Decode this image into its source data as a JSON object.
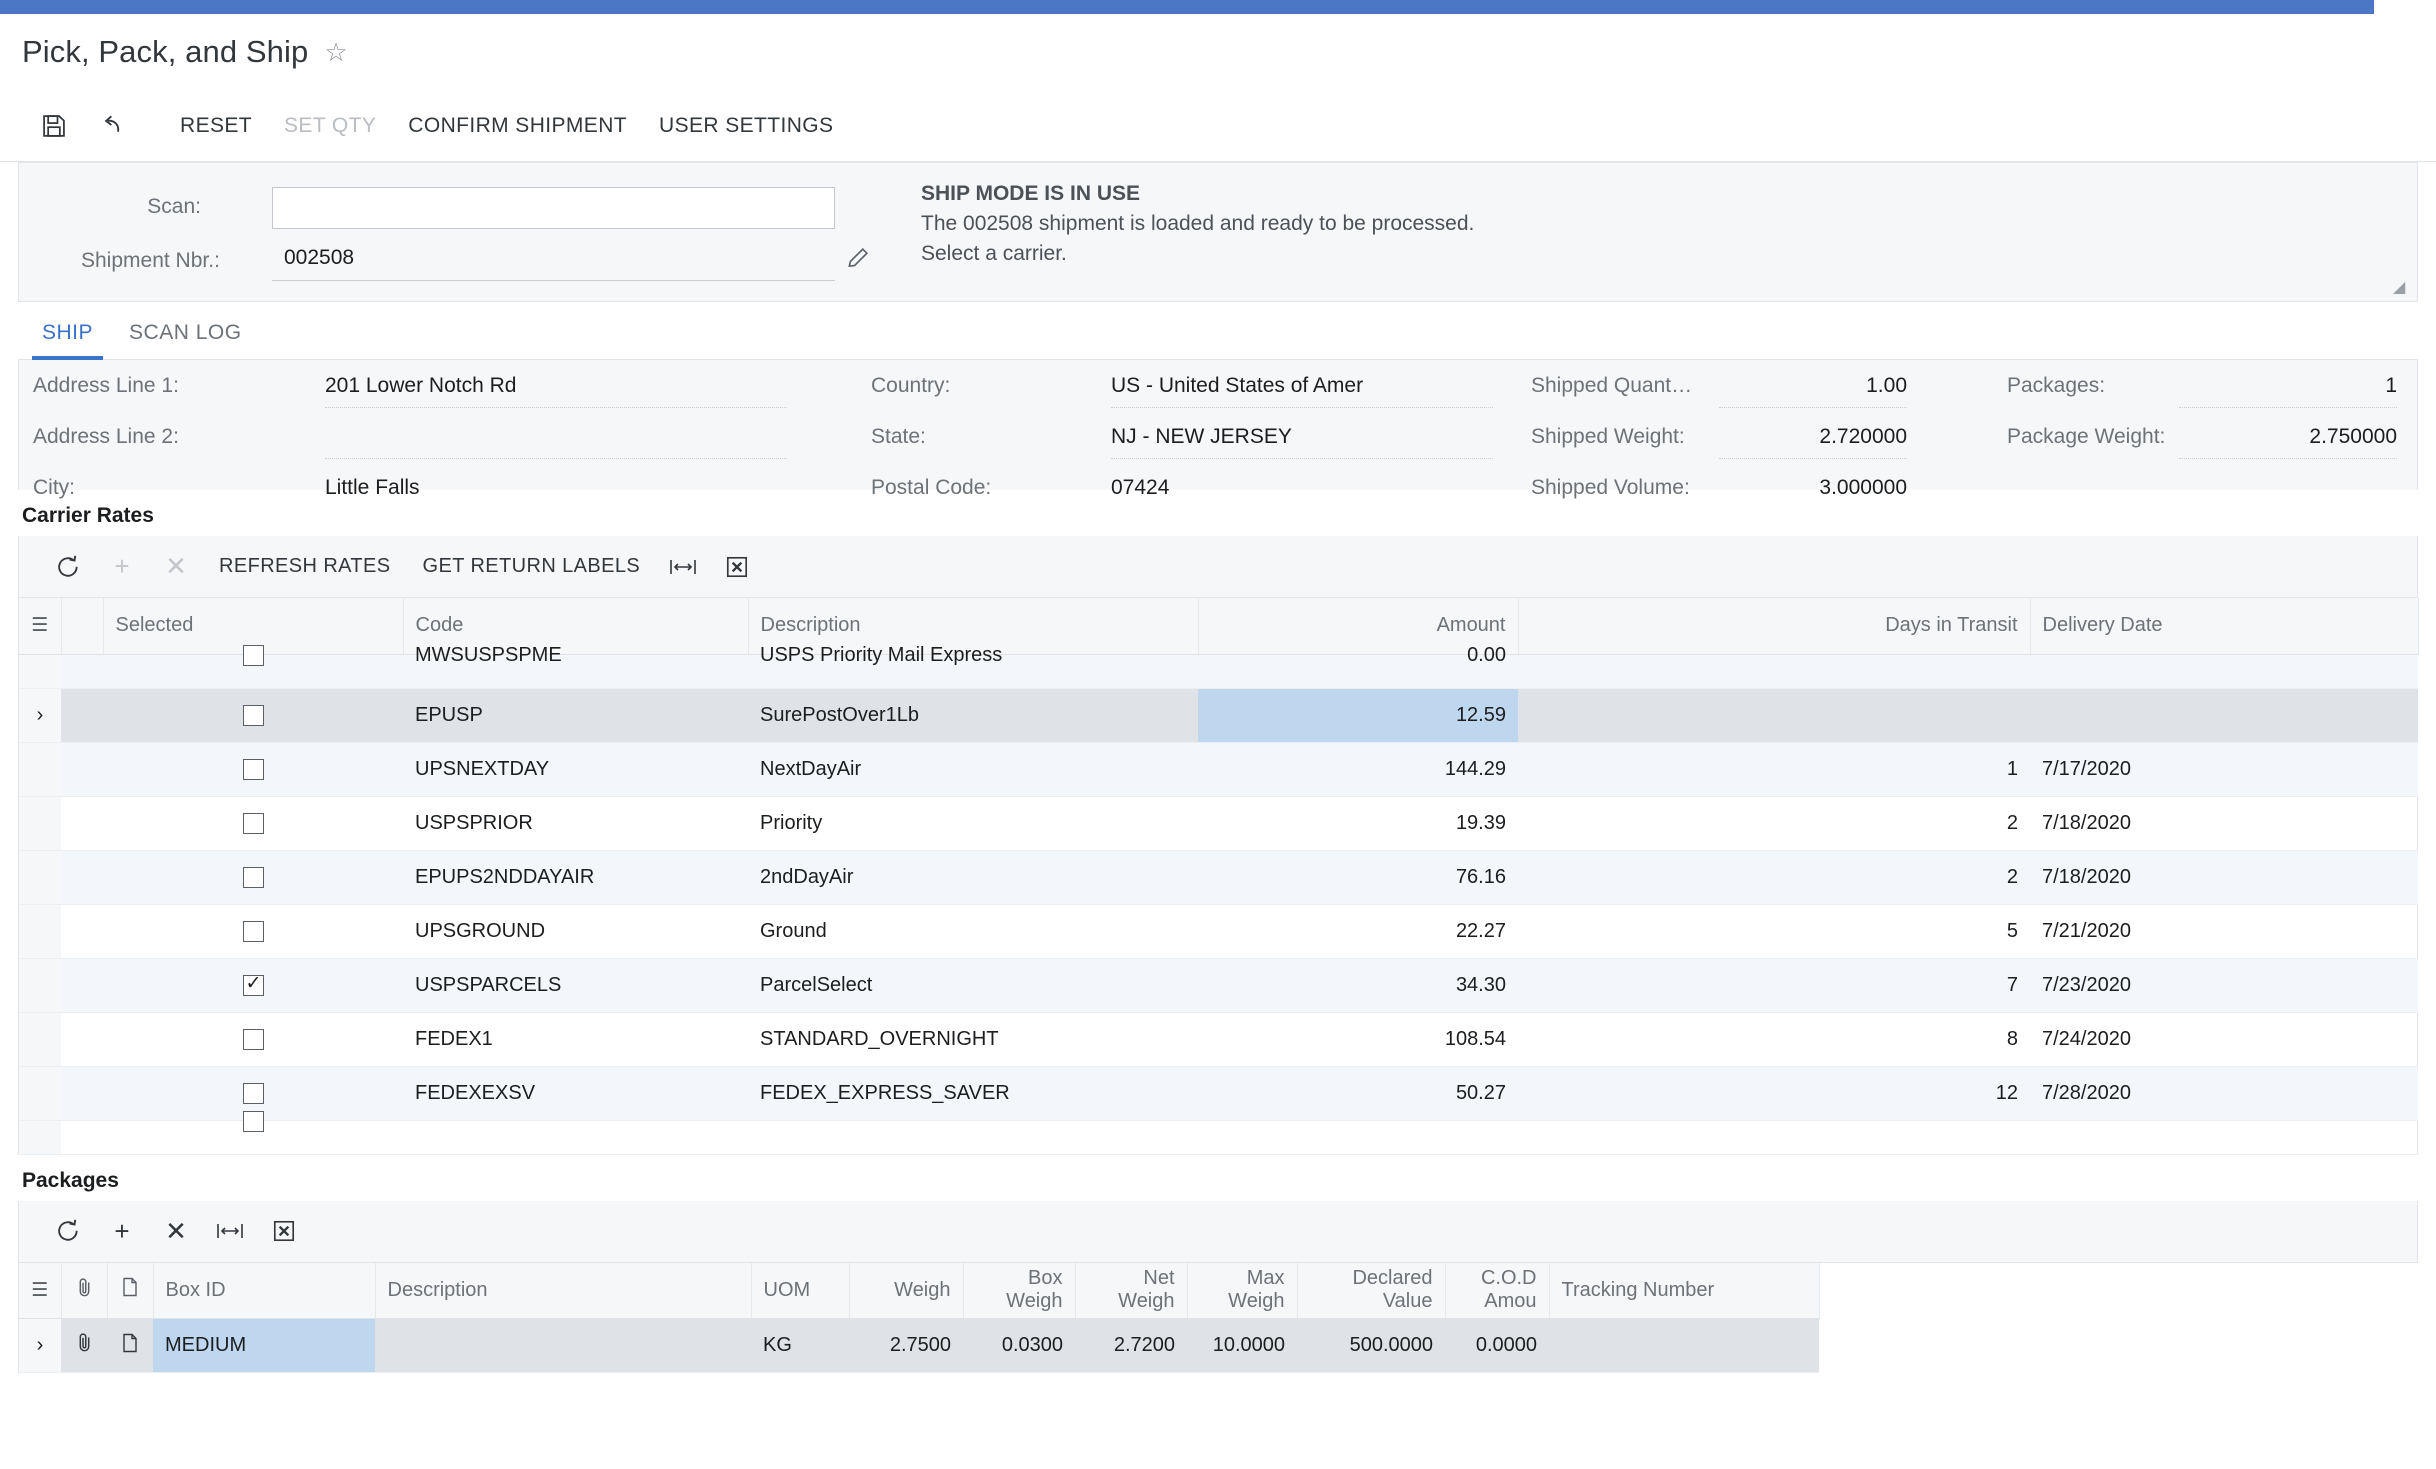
{
  "window": {
    "accent_color": "#4a76c4"
  },
  "header": {
    "title": "Pick, Pack, and Ship",
    "favorite_icon": "star-icon"
  },
  "toolbar": {
    "save_icon": "save-icon",
    "undo_icon": "undo-icon",
    "buttons": [
      {
        "label": "RESET",
        "disabled": false
      },
      {
        "label": "SET QTY",
        "disabled": true
      },
      {
        "label": "CONFIRM SHIPMENT",
        "disabled": false
      },
      {
        "label": "USER SETTINGS",
        "disabled": false
      }
    ]
  },
  "scan_panel": {
    "scan_label": "Scan:",
    "scan_value": "",
    "scan_placeholder": "",
    "shipment_label": "Shipment Nbr.:",
    "shipment_value": "002508",
    "edit_icon": "pencil-icon",
    "message": {
      "title": "SHIP MODE IS IN USE",
      "line1": "The 002508 shipment is loaded and ready to be processed.",
      "line2": "Select a carrier."
    }
  },
  "tabs": [
    {
      "label": "SHIP",
      "active": true
    },
    {
      "label": "SCAN LOG",
      "active": false
    }
  ],
  "form": {
    "col1": [
      {
        "label": "Address Line 1:",
        "value": "201 Lower Notch Rd"
      },
      {
        "label": "Address Line 2:",
        "value": ""
      },
      {
        "label": "City:",
        "value": "Little Falls"
      }
    ],
    "col2": [
      {
        "label": "Country:",
        "value": "US - United States of Amer"
      },
      {
        "label": "State:",
        "value": "NJ - NEW JERSEY"
      },
      {
        "label": "Postal Code:",
        "value": "07424"
      }
    ],
    "col3": [
      {
        "label": "Shipped Quant…",
        "value": "1.00"
      },
      {
        "label": "Shipped Weight:",
        "value": "2.720000"
      },
      {
        "label": "Shipped Volume:",
        "value": "3.000000"
      }
    ],
    "col4": [
      {
        "label": "Packages:",
        "value": "1"
      },
      {
        "label": "Package Weight:",
        "value": "2.750000"
      }
    ]
  },
  "carrier_rates": {
    "section_title": "Carrier Rates",
    "toolbar": {
      "refresh_icon": "refresh-icon",
      "add_icon": "plus-icon",
      "delete_icon": "close-icon",
      "buttons": [
        {
          "label": "REFRESH RATES"
        },
        {
          "label": "GET RETURN LABELS"
        }
      ],
      "fit_icon": "fit-columns-icon",
      "export_icon": "export-excel-icon"
    },
    "columns": [
      "Selected",
      "Code",
      "Description",
      "Amount",
      "Days in Transit",
      "Delivery Date"
    ],
    "rows": [
      {
        "selected": false,
        "code": "MWSUSPSPME",
        "description": "USPS Priority Mail Express",
        "amount": "0.00",
        "days": "",
        "date": "",
        "clipped": true
      },
      {
        "selected": false,
        "code": "EPUSP",
        "description": "SurePostOver1Lb",
        "amount": "12.59",
        "days": "",
        "date": "",
        "active": true
      },
      {
        "selected": false,
        "code": "UPSNEXTDAY",
        "description": "NextDayAir",
        "amount": "144.29",
        "days": "1",
        "date": "7/17/2020"
      },
      {
        "selected": false,
        "code": "USPSPRIOR",
        "description": "Priority",
        "amount": "19.39",
        "days": "2",
        "date": "7/18/2020"
      },
      {
        "selected": false,
        "code": "EPUPS2NDDAYAIR",
        "description": "2ndDayAir",
        "amount": "76.16",
        "days": "2",
        "date": "7/18/2020"
      },
      {
        "selected": false,
        "code": "UPSGROUND",
        "description": "Ground",
        "amount": "22.27",
        "days": "5",
        "date": "7/21/2020"
      },
      {
        "selected": true,
        "code": "USPSPARCELS",
        "description": "ParcelSelect",
        "amount": "34.30",
        "days": "7",
        "date": "7/23/2020"
      },
      {
        "selected": false,
        "code": "FEDEX1",
        "description": "STANDARD_OVERNIGHT",
        "amount": "108.54",
        "days": "8",
        "date": "7/24/2020"
      },
      {
        "selected": false,
        "code": "FEDEXEXSV",
        "description": "FEDEX_EXPRESS_SAVER",
        "amount": "50.27",
        "days": "12",
        "date": "7/28/2020"
      }
    ]
  },
  "packages": {
    "section_title": "Packages",
    "toolbar": {
      "refresh_icon": "refresh-icon",
      "add_icon": "plus-icon",
      "delete_icon": "close-icon",
      "fit_icon": "fit-columns-icon",
      "export_icon": "export-excel-icon"
    },
    "columns": [
      "Box ID",
      "Description",
      "UOM",
      "Weigh",
      "Box Weigh",
      "Net Weigh",
      "Max Weigh",
      "Declared Value",
      "C.O.D Amou",
      "Tracking Number"
    ],
    "rows": [
      {
        "box_id": "MEDIUM",
        "description": "",
        "uom": "KG",
        "weight": "2.7500",
        "box_weight": "0.0300",
        "net_weight": "2.7200",
        "max_weight": "10.0000",
        "declared_value": "500.0000",
        "cod_amount": "0.0000",
        "tracking_number": "",
        "attachment_icon": "paperclip-icon",
        "note_icon": "note-icon"
      }
    ]
  }
}
